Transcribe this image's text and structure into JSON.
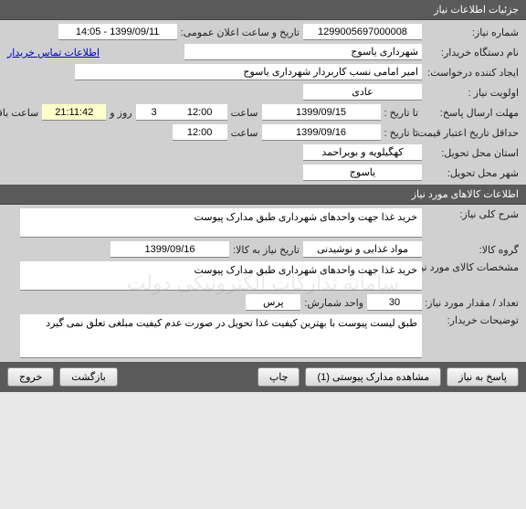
{
  "section1": {
    "title": "جزئیات اطلاعات نیاز"
  },
  "need_number": {
    "label": "شماره نیاز:",
    "value": "1299005697000008",
    "announce_label": "تاریخ و ساعت اعلان عمومی:",
    "announce_value": "1399/09/11 - 14:05"
  },
  "buyer": {
    "label": "نام دستگاه خریدار:",
    "value": "شهرداری یاسوج",
    "contact_link": "اطلاعات تماس خریدار"
  },
  "creator": {
    "label": "ایجاد کننده درخواست:",
    "value": "امیر امامی نسب کاربردار شهرداری یاسوج"
  },
  "priority": {
    "label": "اولویت نیاز :",
    "value": "عادی"
  },
  "deadline": {
    "label": "مهلت ارسال پاسخ:",
    "to_date_label": "تا تاریخ :",
    "to_date": "1399/09/15",
    "time_label": "ساعت",
    "time": "12:00",
    "days": "3",
    "days_label": "روز و",
    "remaining_time": "21:11:42",
    "remaining_label": "ساعت باقی مانده"
  },
  "credit": {
    "label": "حداقل تاریخ اعتبار قیمت:",
    "to_date_label": "تا تاریخ :",
    "to_date": "1399/09/16",
    "time_label": "ساعت",
    "time": "12:00"
  },
  "province": {
    "label": "استان محل تحویل:",
    "value": "کهگیلویه و بویراحمد"
  },
  "city": {
    "label": "شهر محل تحویل:",
    "value": "یاسوج"
  },
  "section2": {
    "title": "اطلاعات کالاهای مورد نیاز"
  },
  "desc": {
    "label": "شرح کلی نیاز:",
    "value": "خرید غذا جهت واحدهای شهرداری طبق مدارک پیوست"
  },
  "group": {
    "label": "گروه کالا:",
    "value": "مواد غذایی و نوشیدنی",
    "date_label": "تاریخ نیاز به کالا:",
    "date": "1399/09/16"
  },
  "spec": {
    "label": "مشخصات کالای مورد نیاز:",
    "value": "خرید غذا جهت واحدهای شهرداری طبق مدارک پیوست"
  },
  "qty": {
    "label": "تعداد / مقدار مورد نیاز:",
    "value": "30",
    "unit_label": "واحد شمارش:",
    "unit": "پرس"
  },
  "notes": {
    "label": "توضیحات خریدار:",
    "value": "طبق لیست پیوست با بهترین کیفیت غذا تحویل در صورت عدم کیفیت مبلغی تعلق نمی گیرد"
  },
  "buttons": {
    "reply": "پاسخ به نیاز",
    "attach": "مشاهده مدارک پیوستی (1)",
    "print": "چاپ",
    "back": "بازگشت",
    "exit": "خروج"
  },
  "watermark": "سامانه تدارکات الکترونیکی دولت"
}
